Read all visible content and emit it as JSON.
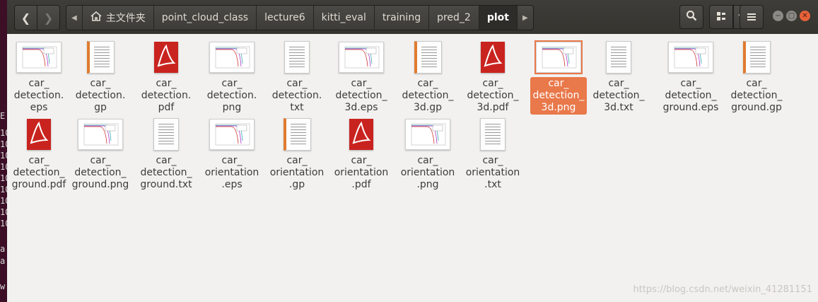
{
  "terminal": {
    "glyphs": [
      "E",
      "10",
      "10",
      "10",
      "10",
      "10",
      "10",
      "10",
      "10",
      "10",
      "a",
      "a",
      "w"
    ]
  },
  "nav": {
    "back_icon": "chevron-left-icon",
    "forward_icon": "chevron-right-icon"
  },
  "breadcrumb": {
    "home_icon": "home-icon",
    "items": [
      "主文件夹",
      "point_cloud_class",
      "lecture6",
      "kitti_eval",
      "training",
      "pred_2",
      "plot"
    ],
    "active": "plot"
  },
  "toolbar": {
    "search_icon": "search-icon",
    "view_icon": "grid-view-icon",
    "menu_icon": "hamburger-menu-icon"
  },
  "window_controls": {
    "minimize": "minimize-icon",
    "maximize": "maximize-icon",
    "close": "close-icon"
  },
  "files": [
    {
      "name": "car_\ndetection.\neps",
      "kind": "eps"
    },
    {
      "name": "car_\ndetection.\ngp",
      "kind": "gp"
    },
    {
      "name": "car_\ndetection.\npdf",
      "kind": "pdf"
    },
    {
      "name": "car_\ndetection.\npng",
      "kind": "png"
    },
    {
      "name": "car_\ndetection.\ntxt",
      "kind": "txt"
    },
    {
      "name": "car_\ndetection_\n3d.eps",
      "kind": "eps"
    },
    {
      "name": "car_\ndetection_\n3d.gp",
      "kind": "gp"
    },
    {
      "name": "car_\ndetection_\n3d.pdf",
      "kind": "pdf"
    },
    {
      "name": "car_\ndetection_\n3d.png",
      "kind": "png",
      "selected": true
    },
    {
      "name": "car_\ndetection_\n3d.txt",
      "kind": "txt"
    },
    {
      "name": "car_\ndetection_\nground.eps",
      "kind": "eps"
    },
    {
      "name": "car_\ndetection_\nground.gp",
      "kind": "gp"
    },
    {
      "name": "car_\ndetection_\nground.pdf",
      "kind": "pdf"
    },
    {
      "name": "car_\ndetection_\nground.png",
      "kind": "png"
    },
    {
      "name": "car_\ndetection_\nground.txt",
      "kind": "txt"
    },
    {
      "name": "car_\norientation\n.eps",
      "kind": "eps"
    },
    {
      "name": "car_\norientation\n.gp",
      "kind": "gp"
    },
    {
      "name": "car_\norientation\n.pdf",
      "kind": "pdf"
    },
    {
      "name": "car_\norientation\n.png",
      "kind": "png"
    },
    {
      "name": "car_\norientation\n.txt",
      "kind": "txt"
    }
  ],
  "watermark": "https://blog.csdn.net/weixin_41281151",
  "colors": {
    "accent": "#e9784a",
    "header": "#3e3d39",
    "background": "#f2f1f0"
  }
}
